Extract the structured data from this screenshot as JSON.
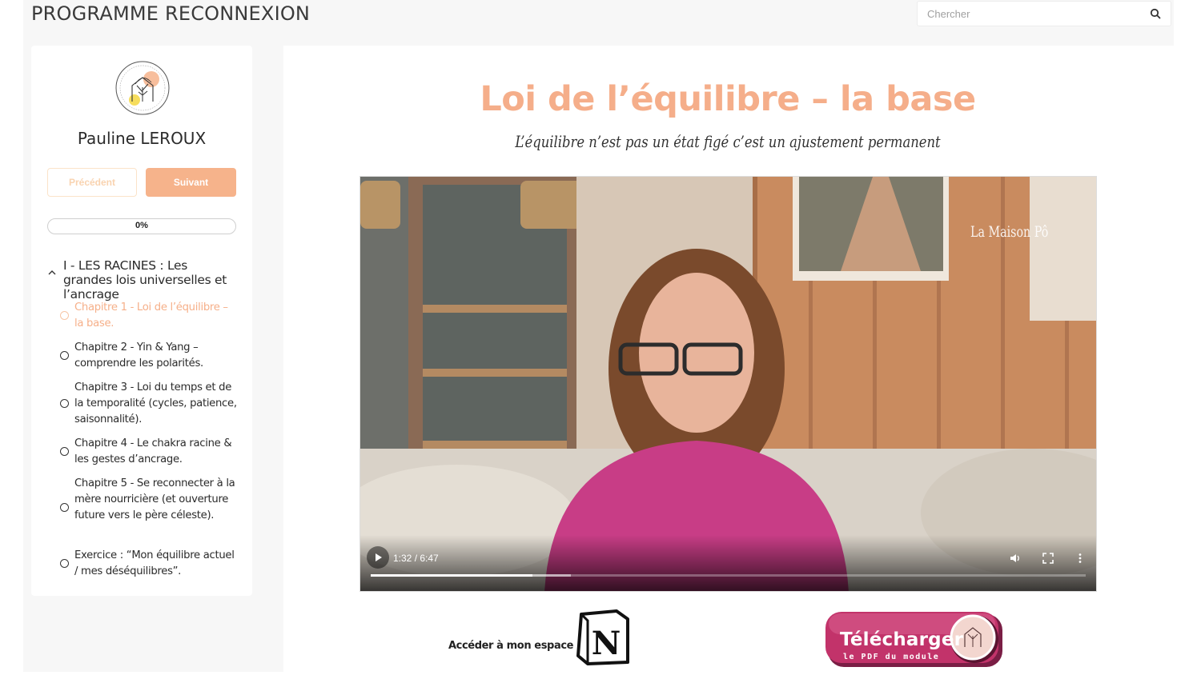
{
  "app": {
    "title": "PROGRAMME RECONNEXION"
  },
  "search": {
    "placeholder": "Chercher",
    "icon": "search-icon"
  },
  "sidebar": {
    "user_name": "Pauline LEROUX",
    "prev_label": "Précédent",
    "next_label": "Suivant",
    "progress": {
      "label": "0%",
      "value": 0
    },
    "section": {
      "title": "I - LES RACINES : Les grandes lois universelles et l’ancrage",
      "expanded": true,
      "chapters": [
        {
          "label": "Chapitre 1 - Loi de l’équilibre – la base.",
          "active": true
        },
        {
          "label": "Chapitre 2 - Yin & Yang – comprendre les polarités.",
          "active": false
        },
        {
          "label": "Chapitre 3 - Loi du temps et de la temporalité (cycles, patience, saisonnalité).",
          "active": false
        },
        {
          "label": "Chapitre 4 - Le chakra racine & les gestes d’ancrage.",
          "active": false
        },
        {
          "label": "Chapitre 5 - Se reconnecter à la mère nourricière (et ouverture future vers le père céleste).",
          "active": false
        },
        {
          "label": "Exercice : “Mon équilibre actuel / mes déséquilibres”.",
          "active": false
        }
      ]
    }
  },
  "main": {
    "title": "Loi de l’équilibre – la base",
    "subtitle": "L’équilibre n’est pas un état figé c’est un ajustement permanent",
    "video": {
      "watermark": "La Maison Pô",
      "time": "1:32 / 6:47",
      "played_fraction": 0.226,
      "buffered_fraction": 0.28
    },
    "notion": {
      "label": "Accéder à mon espace",
      "logo_letter": "N"
    },
    "download": {
      "label": "Télécharger",
      "sublabel": "le PDF du module"
    }
  },
  "colors": {
    "accent": "#f6b38b",
    "title": "#f5ae8a",
    "download_button": "#c2336a",
    "background": "#f7f7f7"
  }
}
